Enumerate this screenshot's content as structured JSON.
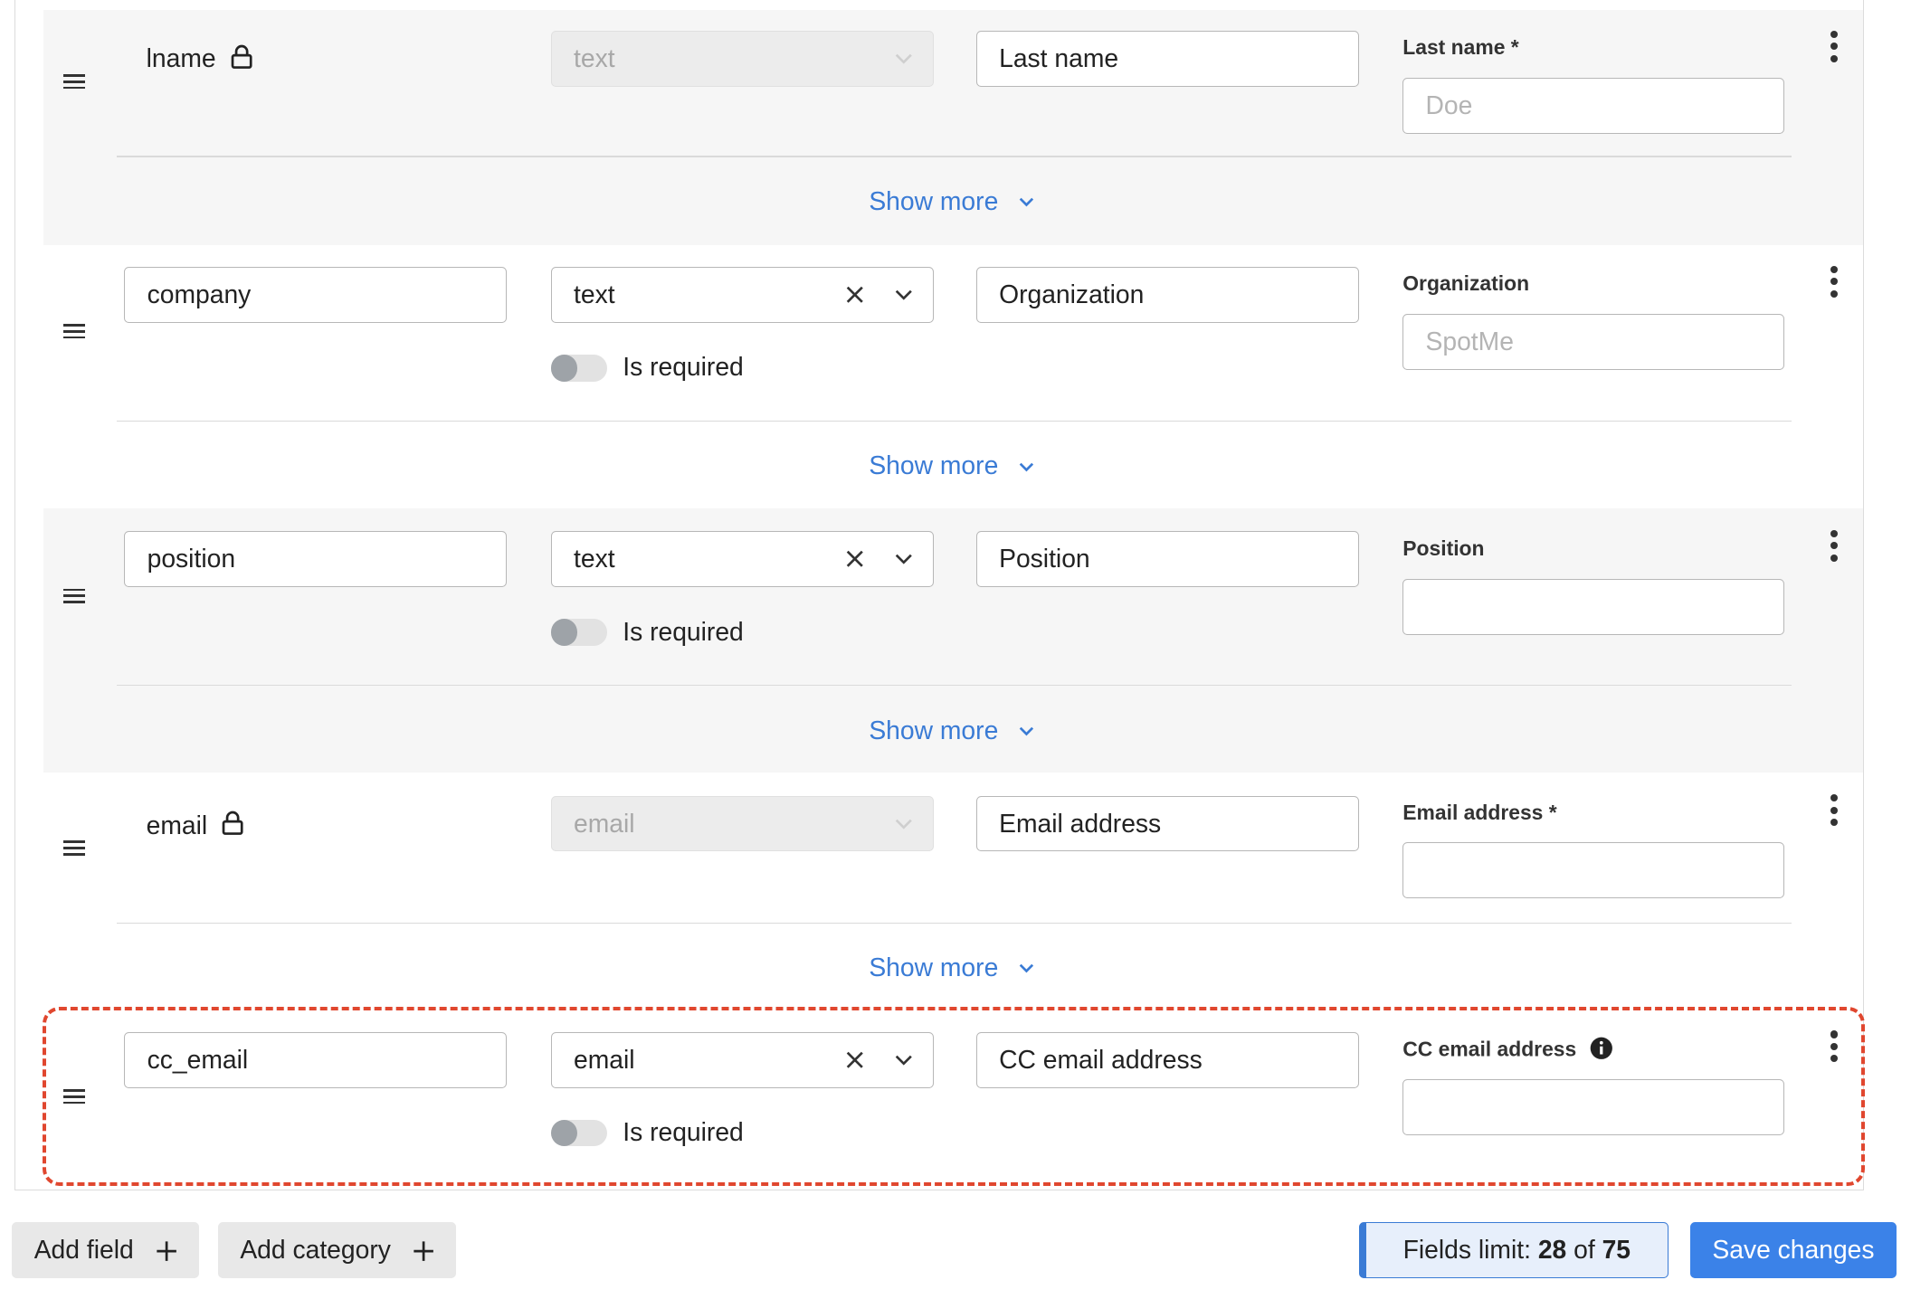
{
  "fields": [
    {
      "locked": true,
      "name": "lname",
      "type": "text",
      "label": "Last name",
      "preview_label": "Last name *",
      "preview_placeholder": "Doe",
      "show_more": "Show more"
    },
    {
      "locked": false,
      "name": "company",
      "type": "text",
      "label": "Organization",
      "required_label": "Is required",
      "required": false,
      "preview_label": "Organization",
      "preview_placeholder": "SpotMe",
      "show_more": "Show more"
    },
    {
      "locked": false,
      "name": "position",
      "type": "text",
      "label": "Position",
      "required_label": "Is required",
      "required": false,
      "preview_label": "Position",
      "preview_placeholder": "",
      "show_more": "Show more"
    },
    {
      "locked": true,
      "name": "email",
      "type": "email",
      "label": "Email address",
      "preview_label": "Email address *",
      "preview_placeholder": "",
      "show_more": "Show more"
    },
    {
      "locked": false,
      "name": "cc_email",
      "type": "email",
      "label": "CC email address",
      "required_label": "Is required",
      "required": false,
      "preview_label": "CC email address",
      "preview_placeholder": "",
      "highlighted": true
    }
  ],
  "footer": {
    "add_field": "Add field",
    "add_category": "Add category",
    "limit_prefix": "Fields limit:",
    "limit_used": "28",
    "limit_of": "of",
    "limit_total": "75",
    "save": "Save changes"
  },
  "colors": {
    "accent": "#3b82e8",
    "link": "#3a7bd5",
    "highlight_border": "#e0472f",
    "row_alt_bg": "#f6f6f6"
  }
}
